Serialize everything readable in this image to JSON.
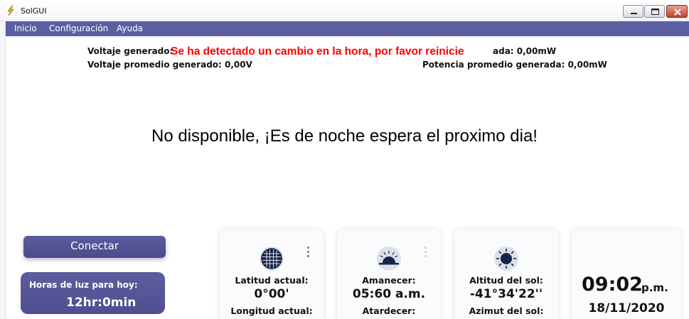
{
  "window": {
    "title": "SolGUI"
  },
  "menu": {
    "items": [
      "Inicio",
      "Configuración",
      "Ayuda"
    ]
  },
  "stats": {
    "voltage_label": "Voltaje generado:",
    "power_suffix": "ada: 0,00mW",
    "avg_voltage": "Voltaje promedio generado: 0,00V",
    "avg_power": "Potencia promedio generada: 0,00mW"
  },
  "warning": {
    "text": "Se ha detectado un cambio en la hora, por favor reinicie",
    "color": "#ff0000"
  },
  "main_message": "No disponible, ¡Es de noche espera el proximo dia!",
  "connect": {
    "label": "Conectar"
  },
  "daylight": {
    "label": "Horas de luz para hoy:",
    "value": "12hr:0min"
  },
  "location_card": {
    "icon": "globe-grid-icon",
    "latitude_label": "Latitud actual:",
    "latitude_value": "0°00'",
    "longitude_label": "Longitud actual:"
  },
  "sun_times_card": {
    "icon": "sunrise-icon",
    "sunrise_label": "Amanecer:",
    "sunrise_value": "05:60 a.m.",
    "sunset_label": "Atardecer:"
  },
  "sun_position_card": {
    "icon": "sun-icon",
    "altitude_label": "Altitud del sol:",
    "altitude_value": "-41°34'22''",
    "azimuth_label": "Azimut del sol:"
  },
  "clock_card": {
    "time": "09:02",
    "ampm": "p.m.",
    "date": "18/11/2020"
  },
  "colors": {
    "accent": "#5b5fa2",
    "card_bg": "#fafbfc",
    "icon_dark": "#16234a"
  }
}
